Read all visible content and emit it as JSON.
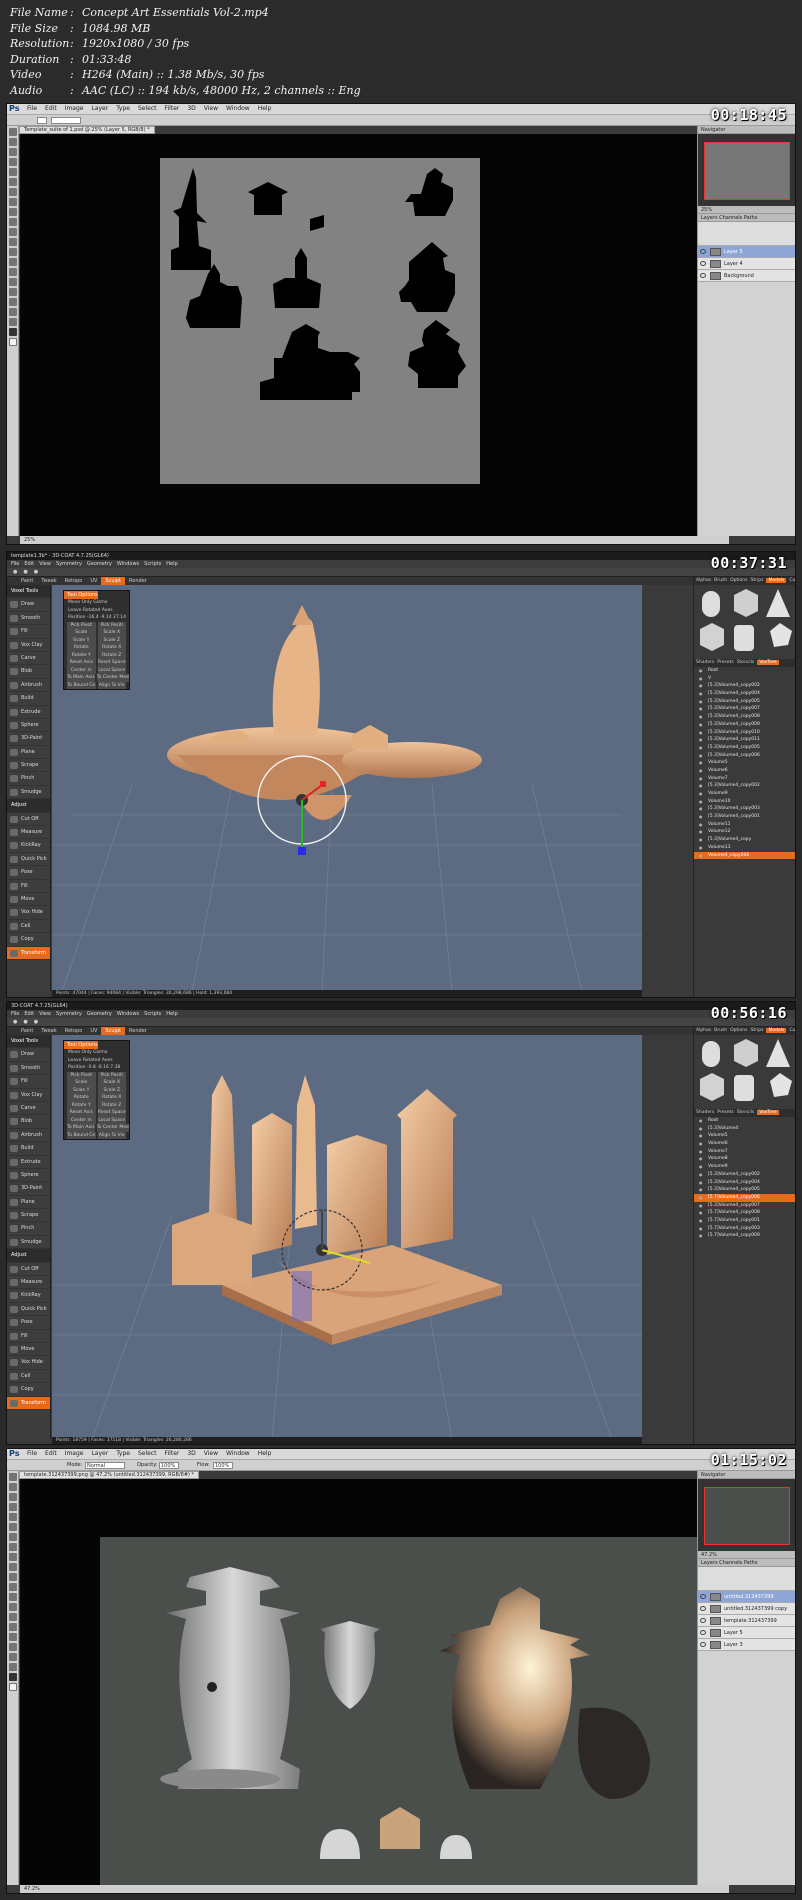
{
  "info": {
    "file_name": {
      "key": "File Name",
      "value": "Concept Art Essentials Vol-2.mp4"
    },
    "file_size": {
      "key": "File Size",
      "value": "1084.98 MB"
    },
    "resolution": {
      "key": "Resolution",
      "value": "1920x1080 / 30 fps"
    },
    "duration": {
      "key": "Duration",
      "value": "01:33:48"
    },
    "video": {
      "key": "Video",
      "value": "H264 (Main) :: 1.38 Mb/s, 30 fps"
    },
    "audio": {
      "key": "Audio",
      "value": "AAC (LC) :: 194 kb/s, 48000 Hz, 2 channels :: Eng"
    }
  },
  "frames": {
    "f1": {
      "timestamp": "00:18:45",
      "app_logo": "Ps",
      "menus": [
        "File",
        "Edit",
        "Image",
        "Layer",
        "Type",
        "Select",
        "Filter",
        "3D",
        "View",
        "Window",
        "Help"
      ],
      "doc_tab": "Template_suite of 1.psd @ 25% (Layer 5, RGB/8) *",
      "status": "25%",
      "panels": {
        "navigator": "Navigator",
        "layers_tabs": "Layers  Channels  Paths",
        "zoom": "25%"
      },
      "layers": [
        "Layer 5",
        "Layer 4",
        "Background"
      ]
    },
    "f2": {
      "timestamp": "00:37:31",
      "title": "template1.3b* - 3D-COAT 4.7.25(GL64)",
      "menus": [
        "File",
        "Edit",
        "View",
        "Symmetry",
        "Geometry",
        "Windows",
        "Scripts",
        "Help"
      ],
      "rooms": [
        "Paint",
        "Tweak",
        "Retopo",
        "UV",
        "Sculpt",
        "Render"
      ],
      "active_room": "Sculpt",
      "tool_options_title": "Tool Options",
      "tool_options": [
        "Move  Only  Gizmo",
        "Leave  Rotated  Axes",
        "Position  -16.4  -9.14  27.14"
      ],
      "tool_buttons": [
        [
          "Pick Pivot",
          "Pick Positi"
        ],
        [
          "Scale",
          "Scale X"
        ],
        [
          "Scale Y",
          "Scale Z"
        ],
        [
          "Rotate",
          "Rotate X"
        ],
        [
          "Rotate Y",
          "Rotate Z"
        ],
        [
          "Reset Axis",
          "Reset Space"
        ],
        [
          "Center in",
          "Local Space"
        ],
        [
          "To Main Axis",
          "To Center Mesh"
        ],
        [
          "To Bound Ce",
          "Align To Vie"
        ]
      ],
      "voxel_tools": [
        "Voxel Tools",
        "Draw",
        "Smooth",
        "Fill",
        "Vox Clay",
        "Carve",
        "Blob",
        "Airbrush",
        "Build",
        "Extrude",
        "Sphere",
        "3D-Paint",
        "Plane",
        "Scrape",
        "Pinch",
        "Smudge",
        "Adjust",
        "Cut Off",
        "Measure",
        "KickRay",
        "Quick Pick",
        "Pose",
        "Fill",
        "Move",
        "Vox Hide",
        "Cell",
        "Copy",
        "Transform"
      ],
      "right_tabs": [
        "Alphas",
        "Brush",
        "Options",
        "Strips",
        "Models",
        "Curves"
      ],
      "right_active": "Models",
      "vox_header": [
        "Shaders",
        "Presets",
        "Stencils",
        "VoxTree"
      ],
      "vox_rows": [
        "Root",
        "V",
        "[5.3]Volume4_copy002",
        "[5.3]Volume4_copy004",
        "[5.3]Volume4_copy005",
        "[5.3]Volume4_copy007",
        "[5.3]Volume4_copy008",
        "[5.3]Volume4_copy009",
        "[5.3]Volume4_copy010",
        "[5.3]Volume4_copy011",
        "[5.3]Volume4_copy005",
        "[5.3]Volume4_copy006",
        "Volume5",
        "Volume6",
        "Volume7",
        "[5.3]Volume4_copy002",
        "Volume9",
        "Volume10",
        "[5.3]Volume4_copy003",
        "[5.3]Volume4_copy001",
        "Volume11",
        "Volume12",
        "[5.3]Volume4_copy",
        "Volume13",
        "Volume4_copy006"
      ],
      "vox_selected": "Volume4_copy006",
      "status": "Points: 47044 | Faces: 94084 | Visible: Triangles: 30,298,686 | Hold: 1,393,084"
    },
    "f3": {
      "timestamp": "00:56:16",
      "title": "3D-COAT 4.7.25(GL64)",
      "menus": [
        "File",
        "Edit",
        "View",
        "Symmetry",
        "Geometry",
        "Windows",
        "Scripts",
        "Help"
      ],
      "rooms": [
        "Paint",
        "Tweak",
        "Retopo",
        "UV",
        "Sculpt",
        "Render"
      ],
      "active_room": "Sculpt",
      "tool_options_title": "Tool Options",
      "tool_options": [
        "Move  Only  Gizmo",
        "Leave  Rotated  Axes",
        "Position  -0.8  -0.16  7.38"
      ],
      "tool_buttons": [
        [
          "Pick Pivot",
          "Pick Positi"
        ],
        [
          "Scale",
          "Scale X"
        ],
        [
          "Scale Y",
          "Scale Z"
        ],
        [
          "Rotate",
          "Rotate X"
        ],
        [
          "Rotate Y",
          "Rotate Z"
        ],
        [
          "Reset Axis",
          "Reset Space"
        ],
        [
          "Center in",
          "Local Space"
        ],
        [
          "To Main Axis",
          "To Center Mesh"
        ],
        [
          "To Bound Ce",
          "Align To Vie"
        ]
      ],
      "right_tabs": [
        "Alphas",
        "Brush",
        "Options",
        "Strips",
        "Models",
        "Curves"
      ],
      "right_active": "Models",
      "vox_header": [
        "Shaders",
        "Presets",
        "Stencils",
        "VoxTree"
      ],
      "vox_rows": [
        "Root",
        "[5.3]Volume4",
        "Volume5",
        "Volume6",
        "Volume7",
        "Volume8",
        "Volume9",
        "[5.3]Volume4_copy002",
        "[5.3]Volume4_copy004",
        "[5.3]Volume4_copy005",
        "[5.7]Volume4_copy006",
        "[5.3]Volume4_copy007",
        "[5.7]Volume4_copy008",
        "[5.7]Volume4_copy001",
        "[5.7]Volume4_copy003",
        "[5.7]Volume4_copy009"
      ],
      "vox_selected": "[5.7]Volume4_copy006",
      "status": "Points: 18759 | Faces: 37518 | Visible: Triangles: 26,280,286"
    },
    "f4": {
      "timestamp": "01:15:02",
      "app_logo": "Ps",
      "menus": [
        "File",
        "Edit",
        "Image",
        "Layer",
        "Type",
        "Select",
        "Filter",
        "3D",
        "View",
        "Window",
        "Help"
      ],
      "opt_mode": "Normal",
      "opt_opacity": "100%",
      "opt_flow": "100%",
      "doc_tab": "template.312437399.png @ 47.2% (untitled.312437399, RGB/8#) *",
      "status": "47.2%",
      "panels": {
        "navigator": "Navigator",
        "layers_tabs": "Layers  Channels  Paths",
        "zoom": "47.2%"
      },
      "layers": [
        "untitled.312437399",
        "untitled.312437399 copy",
        "template.312437399",
        "Layer 5",
        "Layer 3"
      ]
    }
  }
}
